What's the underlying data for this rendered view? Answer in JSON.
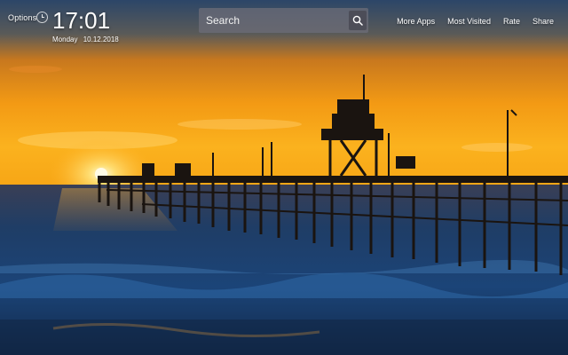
{
  "header": {
    "options_label": "Options",
    "clock_icon": "clock-icon",
    "time": "17:01",
    "date": {
      "weekday": "Monday",
      "date": "10.12.2018"
    }
  },
  "search": {
    "placeholder": "Search",
    "icon": "search-icon"
  },
  "nav": {
    "items": [
      {
        "label": "More Apps"
      },
      {
        "label": "Most Visited"
      },
      {
        "label": "Rate"
      },
      {
        "label": "Share"
      }
    ]
  },
  "background": {
    "subject": "pier at sunset",
    "colors": {
      "sky_top": "#2e4a6e",
      "sky_glow": "#f7a21b",
      "sun": "#fff6c8",
      "sea": "#173a66"
    }
  }
}
